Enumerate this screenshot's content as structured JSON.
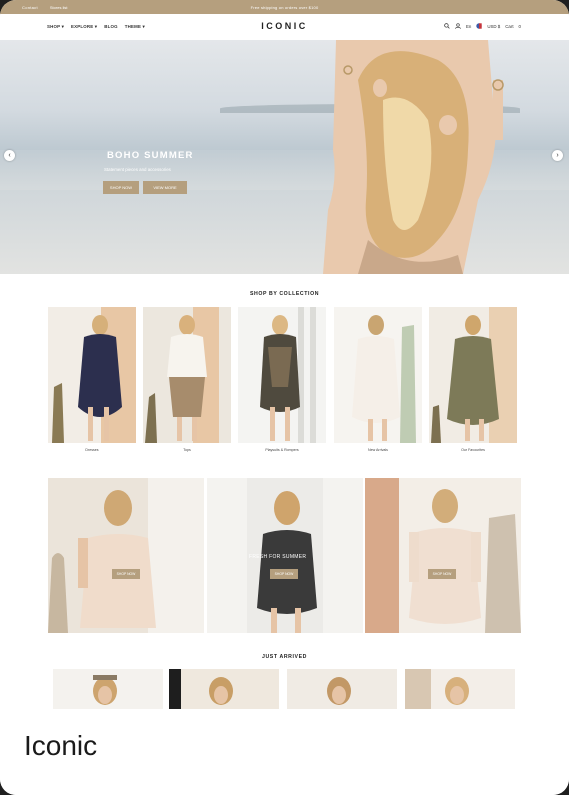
{
  "topbar": {
    "left1": "Contact",
    "left2": "Stores list",
    "promo": "Free shipping on orders over $100",
    "accent": "#b59f7e"
  },
  "nav": {
    "menu": [
      "SHOP ▾",
      "EXPLORE ▾",
      "BLOG",
      "THEME ▾"
    ],
    "logo": "ICONIC",
    "lang": "En",
    "currency": "USD $",
    "cart": "Cart",
    "cart_count": "0"
  },
  "hero": {
    "title": "BOHO SUMMER",
    "subtitle": "Statement pieces and accessories",
    "btn1": "SHOP NOW",
    "btn2": "VIEW MORE"
  },
  "collections": {
    "title": "SHOP BY COLLECTION",
    "items": [
      {
        "label": "Dresses"
      },
      {
        "label": "Tops"
      },
      {
        "label": "Playsuits & Rompers"
      },
      {
        "label": "New Arrivals"
      },
      {
        "label": "Our Favourites"
      }
    ]
  },
  "banners": {
    "center_title": "FRESH FOR SUMMER",
    "items": [
      {
        "btn": "SHOP NOW"
      },
      {
        "btn": "SHOP NOW"
      },
      {
        "btn": "SHOP NOW"
      }
    ]
  },
  "just_arrived": {
    "title": "JUST ARRIVED"
  },
  "caption": {
    "text": "Iconic"
  }
}
